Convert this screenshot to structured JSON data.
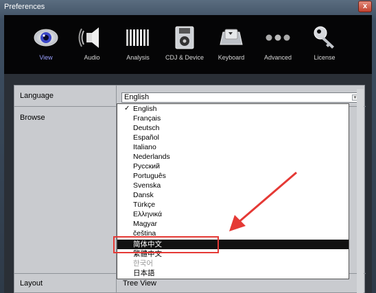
{
  "window": {
    "title": "Preferences",
    "close_label": "x"
  },
  "toolbar": {
    "items": [
      {
        "label": "View",
        "icon": "eye-icon",
        "active": true
      },
      {
        "label": "Audio",
        "icon": "speaker-icon",
        "active": false
      },
      {
        "label": "Analysis",
        "icon": "waveform-bars-icon",
        "active": false
      },
      {
        "label": "CDJ & Device",
        "icon": "disk-icon",
        "active": false
      },
      {
        "label": "Keyboard",
        "icon": "keyboard-key-icon",
        "active": false
      },
      {
        "label": "Advanced",
        "icon": "dots-icon",
        "active": false
      },
      {
        "label": "License",
        "icon": "key-icon",
        "active": false
      }
    ]
  },
  "settings": {
    "language_label": "Language",
    "language_value": "English",
    "browse_label": "Browse",
    "layout_label": "Layout",
    "layout_value": "Tree View"
  },
  "dropdown": {
    "options": [
      "English",
      "Français",
      "Deutsch",
      "Español",
      "Italiano",
      "Nederlands",
      "Русский",
      "Português",
      "Svenska",
      "Dansk",
      "Türkçe",
      "Ελληνικά",
      "Magyar",
      "čeština",
      "简体中文",
      "繁體中文",
      "한국어",
      "日本語"
    ],
    "checked": "English",
    "highlighted": "简体中文"
  },
  "colors": {
    "active_tab": "#9aa0ff",
    "annotation": "#e53935",
    "highlight_bg": "#111111"
  }
}
